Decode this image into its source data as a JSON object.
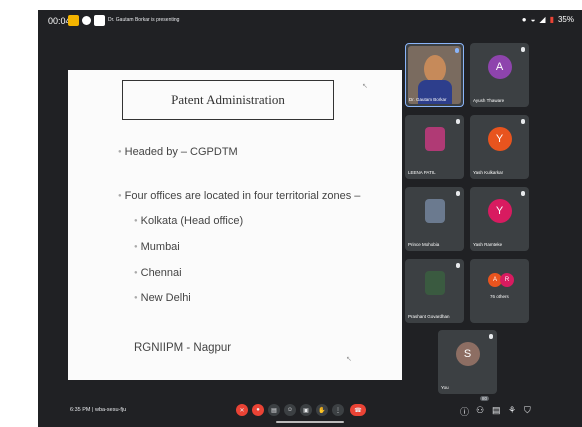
{
  "status_bar": {
    "time": "00:04",
    "presenting_text": "Dr. Gautam Borkar is presenting",
    "battery": "35%"
  },
  "slide": {
    "title": "Patent Administration",
    "headed_by": "Headed by – CGPDTM",
    "offices_intro": "Four offices are located in four territorial zones –",
    "offices": [
      "Kolkata (Head office)",
      "Mumbai",
      "Chennai",
      "New Delhi"
    ],
    "footer": "RGNIIPM - Nagpur"
  },
  "participants": [
    {
      "name": "Dr. Gautam Borkar",
      "type": "video",
      "color": "#7a6b5f"
    },
    {
      "name": "Ayush Thaware",
      "initial": "A",
      "color": "#8e44ad"
    },
    {
      "name": "LEENA PATIL",
      "type": "photo",
      "color": "#b03a75"
    },
    {
      "name": "Yash Kulkarkar",
      "initial": "Y",
      "color": "#e8541e"
    },
    {
      "name": "Prince Mohobia",
      "type": "photo",
      "color": "#6b7a8f"
    },
    {
      "name": "Yash Ramteke",
      "initial": "Y",
      "color": "#d81b60"
    },
    {
      "name": "Prashant Govardhan",
      "type": "photo",
      "color": "#3a5a40"
    },
    {
      "name": "76 others",
      "initials": [
        "A",
        "R"
      ],
      "colors": [
        "#e8541e",
        "#d81b60"
      ]
    },
    {
      "name": "You",
      "initial": "S",
      "color": "#8d6e63"
    }
  ],
  "bottom_bar": {
    "time_code": "6:35 PM | wba-sesu-fju",
    "badge": "80"
  },
  "colors": {
    "background": "#202124",
    "tile": "#3c4043",
    "hangup": "#ea4335",
    "active_border": "#8ab4f8"
  }
}
